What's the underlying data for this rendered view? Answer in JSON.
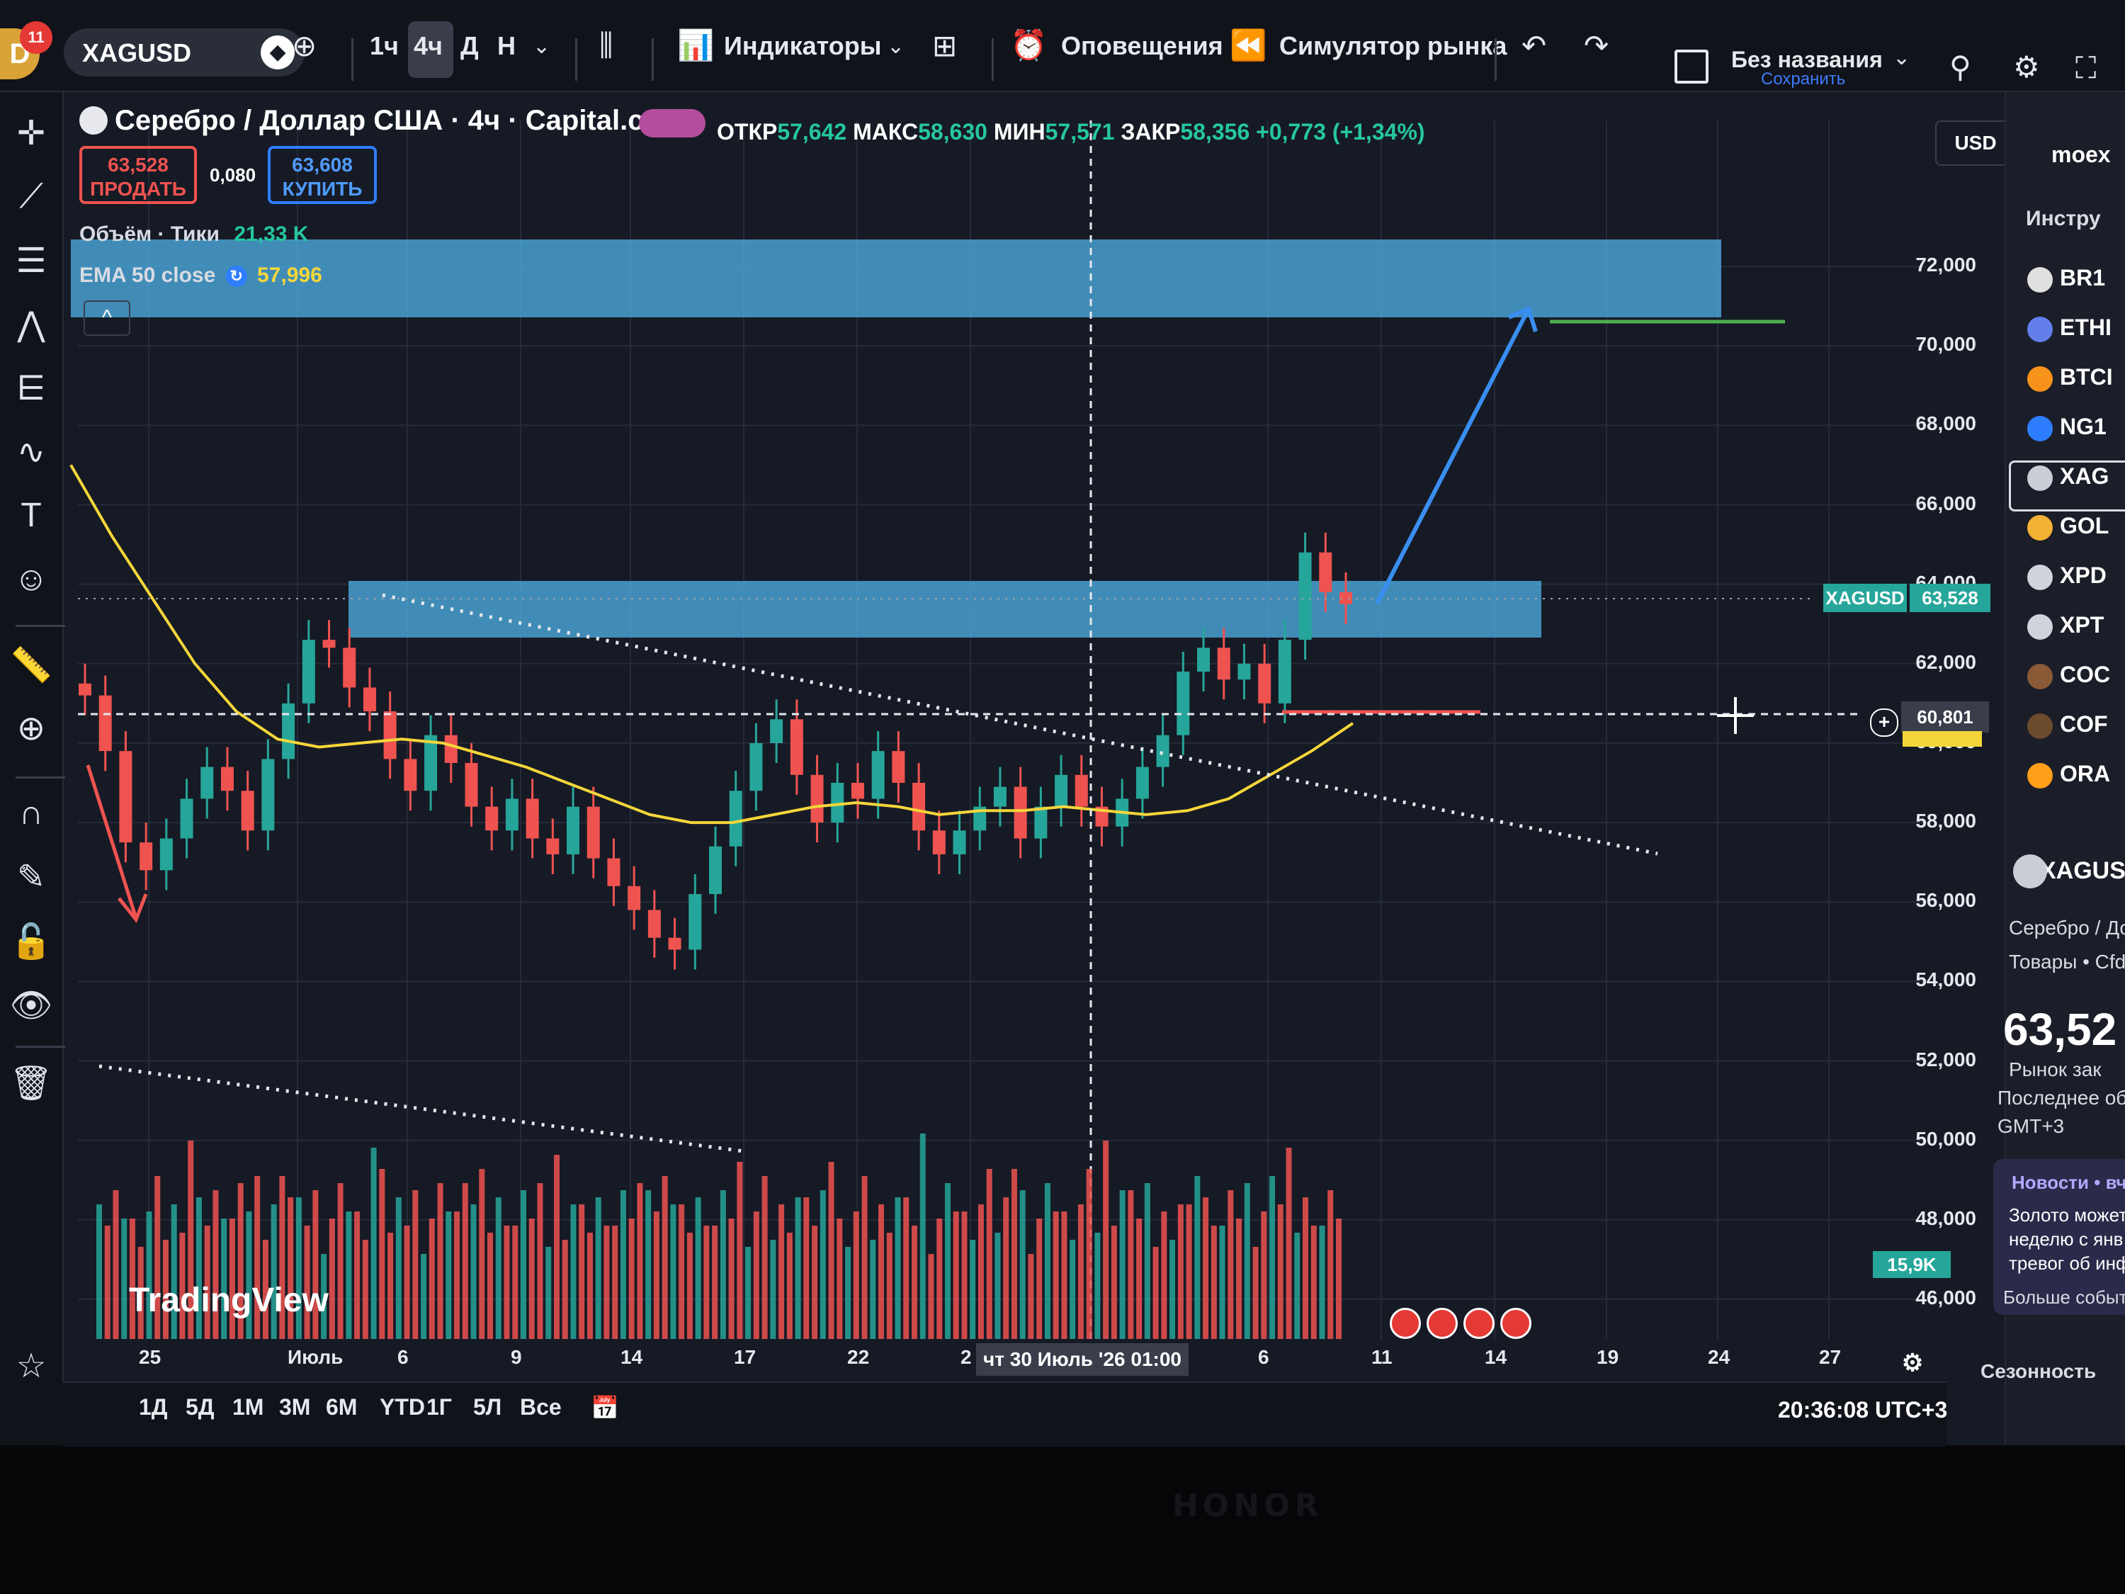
{
  "toolbar": {
    "avatar_letter": "D",
    "notifications": "11",
    "symbol": "XAGUSD",
    "intervals": [
      "1ч",
      "4ч",
      "Д",
      "Н"
    ],
    "indicators_label": "Индикаторы",
    "alerts_label": "Оповещения",
    "replay_label": "Симулятор рынка",
    "layout_name": "Без названия",
    "save_label": "Сохранить"
  },
  "header": {
    "title": "Серебро / Доллар США · 4ч · Capital.com",
    "open_label": "ОТКР",
    "open": "57,642",
    "high_label": "МАКС",
    "high": "58,630",
    "low_label": "МИН",
    "low": "57,571",
    "close_label": "ЗАКР",
    "close": "58,356",
    "change": "+0,773 (+1,34%)",
    "sell_price": "63,528",
    "sell_label": "ПРОДАТЬ",
    "spread": "0,080",
    "buy_price": "63,608",
    "buy_label": "КУПИТЬ",
    "volume_indicator": "Объём · Тики",
    "volume_value": "21,33 K",
    "ema_indicator": "EMA 50 close",
    "ema_value": "57,996"
  },
  "price_axis": {
    "currency": "USD",
    "ticks": [
      "72,000",
      "70,000",
      "68,000",
      "66,000",
      "64,000",
      "62,000",
      "60,000",
      "58,000",
      "56,000",
      "54,000",
      "52,000",
      "50,000",
      "48,000",
      "46,000"
    ],
    "symbol_tag": "XAGUSD",
    "last_price_tag": "63,528",
    "crosshair_price": "60,801",
    "volume_tag": "15,9K"
  },
  "time_axis": {
    "labels": [
      "25",
      "Июль",
      "6",
      "9",
      "14",
      "17",
      "22",
      "2",
      "6",
      "11",
      "14",
      "19",
      "24",
      "27"
    ],
    "crosshair_date": "чт 30 Июль '26   01:00"
  },
  "chart_colors": {
    "up": "#26a69a",
    "down": "#ef5350",
    "ema": "#f5d63a",
    "zone": "#4fb3e8",
    "arrow": "#3a8ef0"
  },
  "chart_data": {
    "type": "candlestick",
    "title": "Серебро / Доллар США · 4ч · Capital.com",
    "xlabel": "",
    "ylabel": "",
    "ylim": [
      45.0,
      73.0
    ],
    "series": [
      {
        "name": "XAGUSD",
        "values": [
          61.2,
          59.8,
          57.5,
          56.8,
          57.6,
          58.6,
          59.4,
          58.8,
          57.8,
          59.6,
          61.0,
          62.6,
          62.4,
          61.4,
          60.8,
          59.6,
          58.8,
          60.2,
          59.5,
          58.4,
          57.8,
          58.6,
          57.6,
          57.2,
          58.4,
          57.1,
          56.4,
          55.8,
          55.1,
          54.8,
          56.2,
          57.4,
          58.8,
          60.0,
          60.6,
          59.2,
          58.0,
          59.0,
          58.6,
          59.8,
          59.0,
          57.8,
          57.2,
          57.8,
          58.4,
          58.9,
          57.6,
          58.4,
          59.2,
          58.4,
          57.9,
          58.6,
          59.4,
          60.2,
          61.8,
          62.4,
          61.6,
          62.0,
          61.0,
          62.6,
          64.8,
          63.8,
          63.5
        ]
      },
      {
        "name": "EMA 50 close",
        "values": [
          67.0,
          65.2,
          63.6,
          62.0,
          60.8,
          60.1,
          59.9,
          60.0,
          60.1,
          60.0,
          59.7,
          59.4,
          59.0,
          58.6,
          58.2,
          58.0,
          58.0,
          58.2,
          58.4,
          58.5,
          58.4,
          58.2,
          58.3,
          58.3,
          58.4,
          58.3,
          58.2,
          58.3,
          58.6,
          59.2,
          59.8,
          60.5
        ]
      }
    ],
    "volume": "Объём · Тики 21,33 K"
  },
  "watchlist": {
    "header": "moex",
    "tools_label": "Инстру",
    "items": [
      {
        "label": "BR1",
        "color": "#e0e0e0"
      },
      {
        "label": "ETHI",
        "color": "#627eea"
      },
      {
        "label": "BTCI",
        "color": "#f7931a"
      },
      {
        "label": "NG1",
        "color": "#2f7dff"
      },
      {
        "label": "XAG",
        "color": "#c9cdd6"
      },
      {
        "label": "GOL",
        "color": "#f2b233"
      },
      {
        "label": "XPD",
        "color": "#cfd3dc"
      },
      {
        "label": "XPT",
        "color": "#cfd3dc"
      },
      {
        "label": "COC",
        "color": "#8a5a36"
      },
      {
        "label": "COF",
        "color": "#6b4a2e"
      },
      {
        "label": "ORA",
        "color": "#ff9f1a"
      }
    ]
  },
  "details": {
    "symbol": "XAGUS",
    "name": "Серебро / До",
    "category": "Товары • Cfd",
    "price": "63,52",
    "market_status": "Рынок зак",
    "last_update": "Последнее об",
    "timezone": "GMT+3",
    "news_label": "Новости • вч",
    "news_text": [
      "Золото может",
      "неделю с янв",
      "тревог об инф"
    ],
    "more_events": "Больше событ",
    "seasonality": "Сезонность"
  },
  "bottom": {
    "ranges": [
      "1Д",
      "5Д",
      "1М",
      "3М",
      "6М",
      "YTD",
      "1Г",
      "5Л",
      "Все"
    ],
    "clock": "20:36:08 UTC+3"
  },
  "watermark": "TradingView",
  "device_brand": "HONOR"
}
